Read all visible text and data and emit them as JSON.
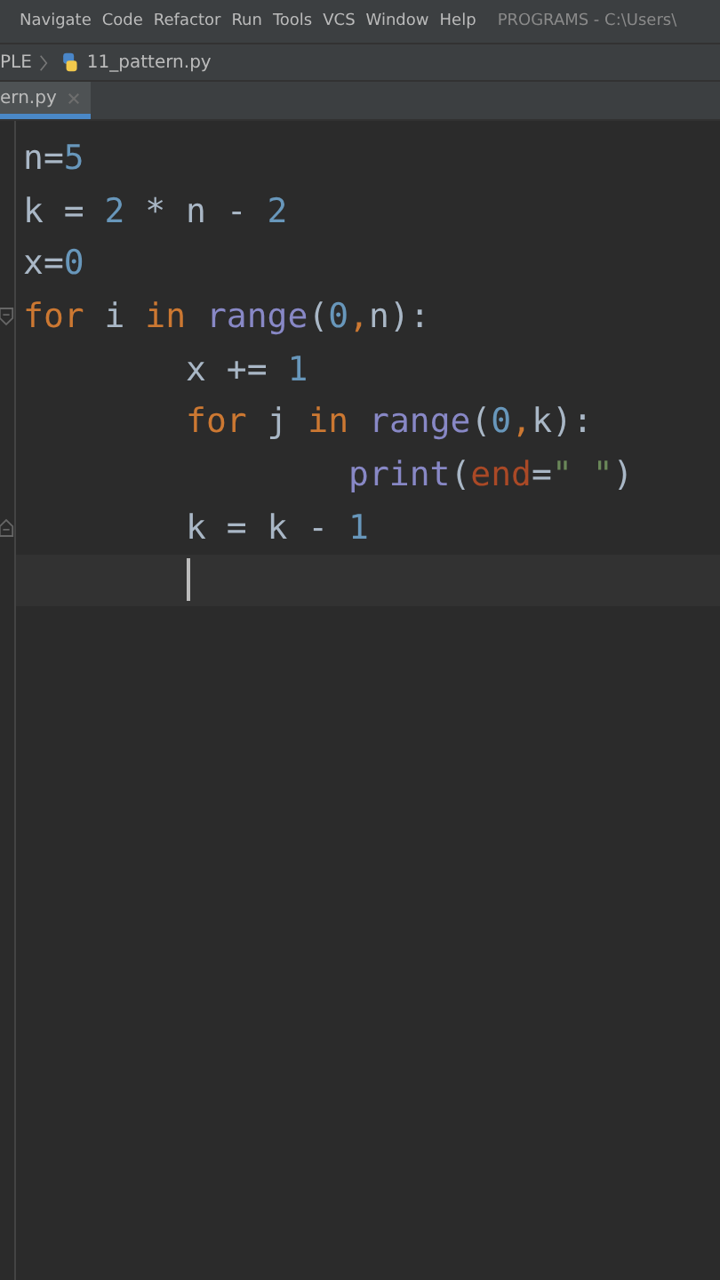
{
  "menu": [
    "Navigate",
    "Code",
    "Refactor",
    "Run",
    "Tools",
    "VCS",
    "Window",
    "Help"
  ],
  "window": {
    "title": "PROGRAMS - C:\\Users\\"
  },
  "breadcrumb": [
    "PLE",
    "11_pattern.py"
  ],
  "tabs": [
    {
      "label": "ern.py",
      "selected": true
    }
  ],
  "editor": {
    "lines": [
      {
        "current": false,
        "tokens": [
          {
            "kind": "plain",
            "text": "n="
          },
          {
            "kind": "num",
            "text": "5"
          }
        ]
      },
      {
        "current": false,
        "tokens": [
          {
            "kind": "plain",
            "text": "k = "
          },
          {
            "kind": "num",
            "text": "2"
          },
          {
            "kind": "plain",
            "text": " * n - "
          },
          {
            "kind": "num",
            "text": "2"
          }
        ]
      },
      {
        "current": false,
        "tokens": [
          {
            "kind": "plain",
            "text": "x="
          },
          {
            "kind": "num",
            "text": "0"
          }
        ]
      },
      {
        "current": false,
        "fold_start": true,
        "tokens": [
          {
            "kind": "kw",
            "text": "for"
          },
          {
            "kind": "plain",
            "text": " i "
          },
          {
            "kind": "kw",
            "text": "in"
          },
          {
            "kind": "builtin",
            "text": " range"
          },
          {
            "kind": "plain",
            "text": "("
          },
          {
            "kind": "num",
            "text": "0"
          },
          {
            "kind": "kw",
            "text": ","
          },
          {
            "kind": "plain",
            "text": "n):"
          }
        ]
      },
      {
        "current": false,
        "tokens": [
          {
            "kind": "plain",
            "text": "        x += "
          },
          {
            "kind": "num",
            "text": "1"
          }
        ]
      },
      {
        "current": false,
        "tokens": [
          {
            "kind": "kw",
            "text": "        for"
          },
          {
            "kind": "plain",
            "text": " j "
          },
          {
            "kind": "kw",
            "text": "in"
          },
          {
            "kind": "builtin",
            "text": " range"
          },
          {
            "kind": "plain",
            "text": "("
          },
          {
            "kind": "num",
            "text": "0"
          },
          {
            "kind": "kw",
            "text": ","
          },
          {
            "kind": "plain",
            "text": "k):"
          }
        ]
      },
      {
        "current": false,
        "tokens": [
          {
            "kind": "builtin",
            "text": "                print"
          },
          {
            "kind": "plain",
            "text": "("
          },
          {
            "kind": "param",
            "text": "end"
          },
          {
            "kind": "plain",
            "text": "="
          },
          {
            "kind": "str",
            "text": "\" \""
          },
          {
            "kind": "plain",
            "text": ")"
          }
        ]
      },
      {
        "current": false,
        "fold_end": true,
        "tokens": [
          {
            "kind": "plain",
            "text": "        k = k - "
          },
          {
            "kind": "num",
            "text": "1"
          }
        ]
      },
      {
        "current": true,
        "caret": true
      }
    ]
  }
}
